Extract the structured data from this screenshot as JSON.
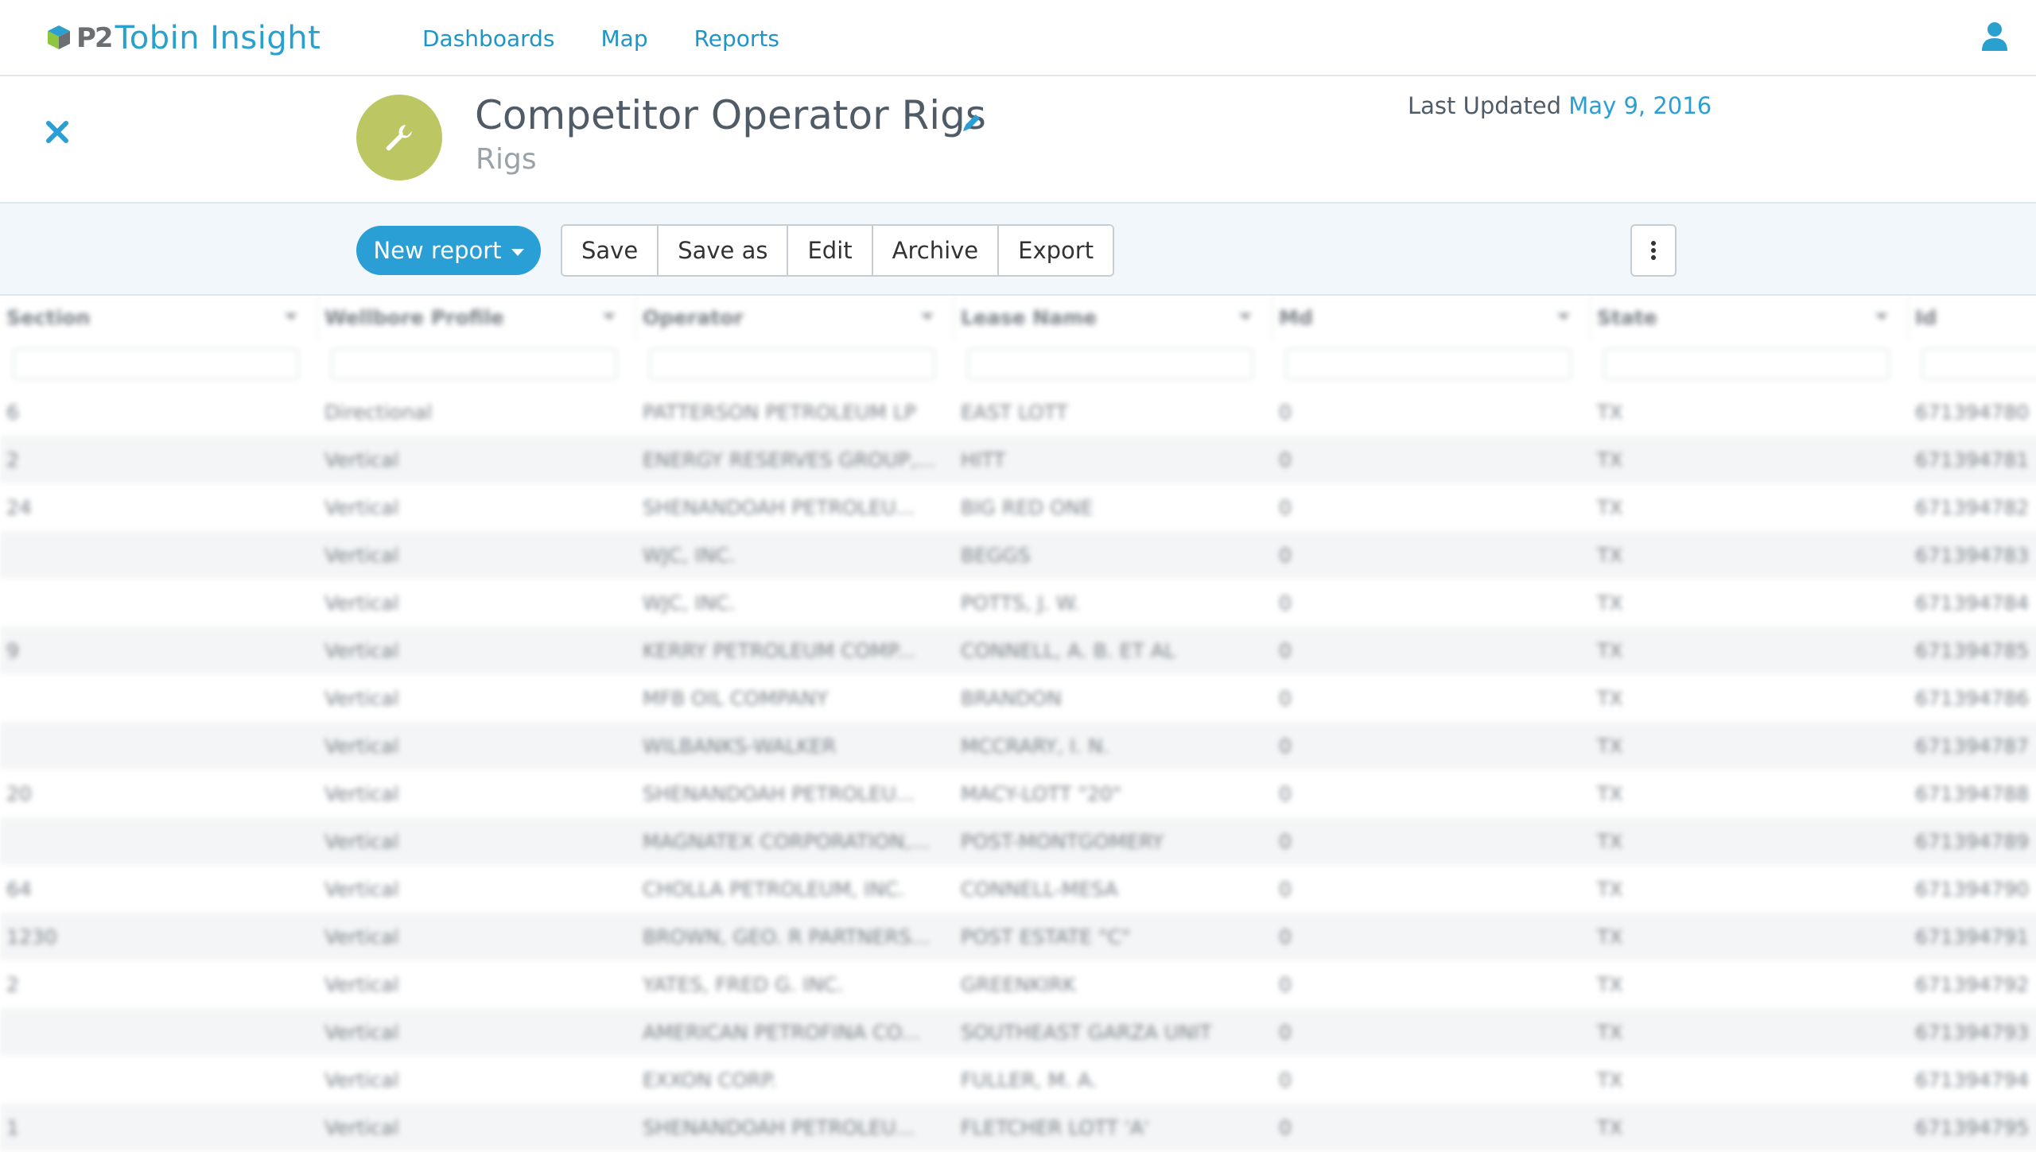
{
  "app": {
    "brand_prefix": "P2",
    "brand_name": "Tobin Insight"
  },
  "nav": {
    "items": [
      "Dashboards",
      "Map",
      "Reports"
    ]
  },
  "header": {
    "title": "Competitor Operator Rigs",
    "subtitle": "Rigs",
    "last_updated_label": "Last Updated",
    "last_updated_date": "May 9, 2016"
  },
  "toolbar": {
    "new_report_label": "New report",
    "buttons": [
      "Save",
      "Save as",
      "Edit",
      "Archive",
      "Export"
    ]
  },
  "colors": {
    "accent": "#2a9fd6",
    "avatar": "#bcc662"
  },
  "icons": {
    "close": "close-icon",
    "wrench": "wrench-icon",
    "pencil": "pencil-icon",
    "user": "user-icon",
    "more": "more-vertical-icon"
  },
  "grid": {
    "columns": [
      "Section",
      "Wellbore Profile",
      "Operator",
      "Lease Name",
      "Md",
      "State",
      "Id"
    ],
    "rows": [
      [
        "6",
        "Directional",
        "PATTERSON PETROLEUM LP",
        "EAST LOTT",
        "0",
        "TX",
        "671394780"
      ],
      [
        "2",
        "Vertical",
        "ENERGY RESERVES GROUP,...",
        "HITT",
        "0",
        "TX",
        "671394781"
      ],
      [
        "24",
        "Vertical",
        "SHENANDOAH PETROLEU...",
        "BIG RED ONE",
        "0",
        "TX",
        "671394782"
      ],
      [
        "",
        "Vertical",
        "WJC, INC.",
        "BEGGS",
        "0",
        "TX",
        "671394783"
      ],
      [
        "",
        "Vertical",
        "WJC, INC.",
        "POTTS, J. W.",
        "0",
        "TX",
        "671394784"
      ],
      [
        "9",
        "Vertical",
        "KERRY PETROLEUM COMP...",
        "CONNELL, A. B. ET AL",
        "0",
        "TX",
        "671394785"
      ],
      [
        "",
        "Vertical",
        "MFB OIL COMPANY",
        "BRANDON",
        "0",
        "TX",
        "671394786"
      ],
      [
        "",
        "Vertical",
        "WILBANKS-WALKER",
        "MCCRARY, I. N.",
        "0",
        "TX",
        "671394787"
      ],
      [
        "20",
        "Vertical",
        "SHENANDOAH PETROLEU...",
        "MACY-LOTT \"20\"",
        "0",
        "TX",
        "671394788"
      ],
      [
        "",
        "Vertical",
        "MAGNATEX CORPORATION,...",
        "POST-MONTGOMERY",
        "0",
        "TX",
        "671394789"
      ],
      [
        "64",
        "Vertical",
        "CHOLLA PETROLEUM, INC.",
        "CONNELL-MESA",
        "0",
        "TX",
        "671394790"
      ],
      [
        "1230",
        "Vertical",
        "BROWN, GEO. R PARTNERS...",
        "POST ESTATE \"C\"",
        "0",
        "TX",
        "671394791"
      ],
      [
        "2",
        "Vertical",
        "YATES, FRED G. INC.",
        "GREENKIRK",
        "0",
        "TX",
        "671394792"
      ],
      [
        "",
        "Vertical",
        "AMERICAN PETROFINA CO...",
        "SOUTHEAST GARZA UNIT",
        "0",
        "TX",
        "671394793"
      ],
      [
        "",
        "Vertical",
        "EXXON CORP.",
        "FULLER, M. A.",
        "0",
        "TX",
        "671394794"
      ],
      [
        "1",
        "Vertical",
        "SHENANDOAH PETROLEU...",
        "FLETCHER LOTT 'A'",
        "0",
        "TX",
        "671394795"
      ]
    ]
  }
}
